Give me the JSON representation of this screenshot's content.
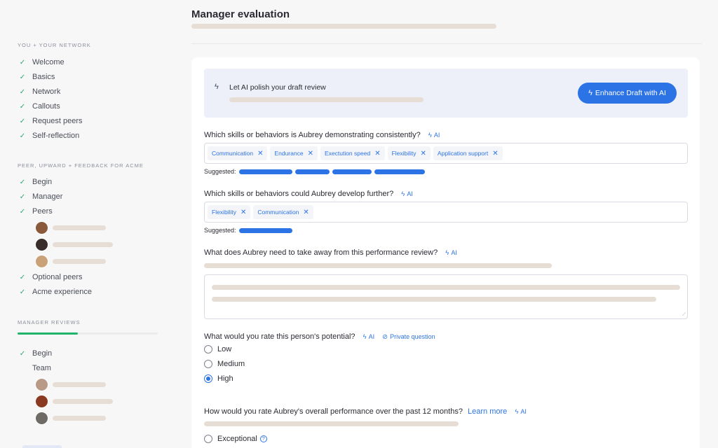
{
  "sidebar": {
    "section1_title": "YOU + YOUR NETWORK",
    "section1_items": [
      "Welcome",
      "Basics",
      "Network",
      "Callouts",
      "Request peers",
      "Self-reflection"
    ],
    "section2_title": "PEER, UPWARD + FEEDBACK FOR ACME",
    "section2_items": [
      "Begin",
      "Manager",
      "Peers"
    ],
    "section2_items_after": [
      "Optional peers",
      "Acme experience"
    ],
    "section3_title": "MANAGER REVIEWS",
    "section3_items": [
      "Begin",
      "Team"
    ],
    "manager_reviews_progress": 0.43
  },
  "header": {
    "title": "Manager evaluation"
  },
  "banner": {
    "label": "Let AI polish your draft review",
    "button_label": "Enhance Draft with AI"
  },
  "q1": {
    "label": "Which skills or behaviors is Aubrey demonstrating consistently?",
    "ai": "AI",
    "tags": [
      "Communication",
      "Endurance",
      "Exectution speed",
      "Flexibility",
      "Application support"
    ],
    "suggested_label": "Suggested:"
  },
  "q2": {
    "label": "Which skills or behaviors could Aubrey develop further?",
    "ai": "AI",
    "tags": [
      "Flexibility",
      "Communication"
    ],
    "suggested_label": "Suggested:"
  },
  "q3": {
    "label": "What does Aubrey need to take away from this performance review?",
    "ai": "AI"
  },
  "q4": {
    "label": "What would you rate this person's potential?",
    "ai": "AI",
    "private": "Private question",
    "options": [
      "Low",
      "Medium",
      "High"
    ],
    "selected": "High"
  },
  "q5": {
    "label": "How would you rate Aubrey's overall performance over the past 12 months?",
    "learn_more": "Learn more",
    "ai": "AI",
    "options": [
      "Exceptional"
    ]
  },
  "colors": {
    "accent": "#2c73e6",
    "check": "#2ea66a",
    "progress": "#20b36a",
    "skeleton": "#e6ddd4"
  }
}
